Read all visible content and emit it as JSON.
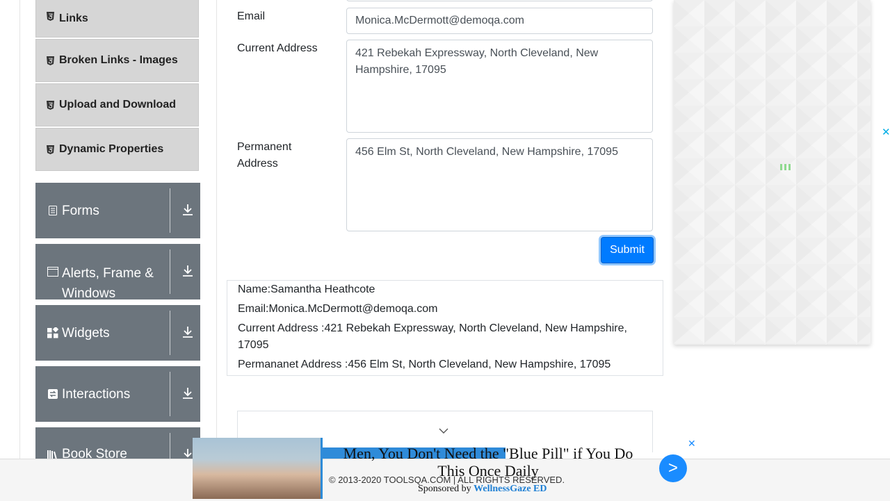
{
  "sidebar": {
    "sub_items": [
      {
        "label": "Links",
        "icon": "html5-icon"
      },
      {
        "label": "Broken Links - Images",
        "icon": "html5-icon"
      },
      {
        "label": "Upload and Download",
        "icon": "html5-icon"
      },
      {
        "label": "Dynamic Properties",
        "icon": "html5-icon"
      }
    ],
    "groups": [
      {
        "label": "Forms",
        "icon": "form-icon"
      },
      {
        "label": "Alerts, Frame & Windows",
        "icon": "window-icon"
      },
      {
        "label": "Widgets",
        "icon": "widgets-icon"
      },
      {
        "label": "Interactions",
        "icon": "interactions-icon"
      },
      {
        "label": "Book Store Application",
        "icon": "book-icon"
      }
    ]
  },
  "form": {
    "email_label": "Email",
    "email_value": "Monica.McDermott@demoqa.com",
    "current_address_label": "Current Address",
    "current_address_value": "421 Rebekah Expressway, North Cleveland, New Hampshire, 17095",
    "permanent_address_label": "Permanent Address",
    "permanent_address_value": "456 Elm St, North Cleveland, New Hampshire, 17095",
    "submit_label": "Submit"
  },
  "output": {
    "name": "Name:Samantha Heathcote",
    "email": "Email:Monica.McDermott@demoqa.com",
    "current_address": "Current Address :421 Rebekah Expressway, North Cleveland, New Hampshire, 17095",
    "permanent_address": "Permananet Address :456 Elm St, North Cleveland, New Hampshire, 17095"
  },
  "footer": {
    "copyright": "© 2013-2020 TOOLSQA.COM | ALL RIGHTS RESERVED."
  },
  "bottom_ad": {
    "headline": "Men, You Don't Need the \"Blue Pill\" if You Do This Once Daily",
    "sponsored_prefix": "Sponsored by",
    "sponsor": "WellnessGaze ED",
    "arrow": ">",
    "close": "✕"
  },
  "right_ad": {
    "close": "✕"
  },
  "colors": {
    "primary": "#007bff",
    "sidebar_group": "#6c757d",
    "sidebar_item": "#d6d6d6"
  }
}
